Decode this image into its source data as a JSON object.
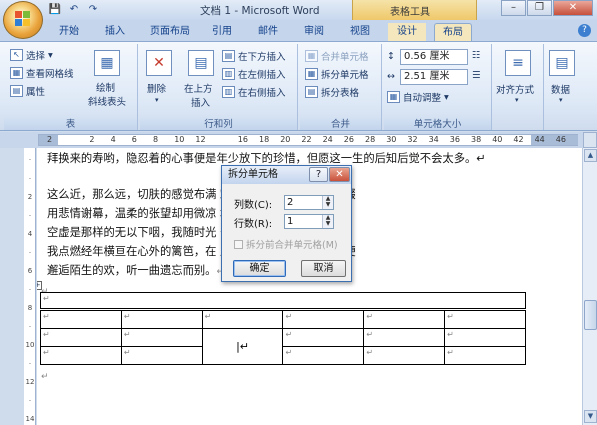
{
  "window": {
    "title": "文档 1 - Microsoft Word",
    "contextual_tab_group": "表格工具",
    "controls": [
      "–",
      "❐",
      "✕"
    ]
  },
  "quick_access": {
    "save": "💾",
    "undo": "↶",
    "redo": "↷"
  },
  "tabs": [
    "开始",
    "插入",
    "页面布局",
    "引用",
    "邮件",
    "审阅",
    "视图",
    "设计",
    "布局"
  ],
  "active_tab": "布局",
  "ribbon": {
    "table_group": {
      "label": "表",
      "select": "选择",
      "gridlines": "查看网格线",
      "properties": "属性"
    },
    "draw_group": {
      "draw_line1": "绘制",
      "draw_line2": "斜线表头"
    },
    "rows_cols_group": {
      "label": "行和列",
      "delete": "删除",
      "insert_above_1": "在上方",
      "insert_above_2": "插入",
      "insert_below": "在下方插入",
      "insert_left": "在左侧插入",
      "insert_right": "在右侧插入"
    },
    "merge_group": {
      "label": "合并",
      "merge_cells": "合并单元格",
      "split_cells": "拆分单元格",
      "split_table": "拆分表格"
    },
    "cell_size_group": {
      "label": "单元格大小",
      "height": "0.56 厘米",
      "width": "2.51 厘米",
      "autofit": "自动调整"
    },
    "alignment": "对齐方式",
    "data": "数据"
  },
  "ruler": {
    "ticks": [
      "2",
      "",
      "2",
      "4",
      "6",
      "8",
      "10",
      "12",
      "",
      "16",
      "18",
      "20",
      "22",
      "24",
      "26",
      "28",
      "30",
      "32",
      "34",
      "36",
      "38",
      "40",
      "42",
      "44",
      "46"
    ],
    "vticks": [
      "",
      "",
      "2",
      "",
      "4",
      "",
      "6",
      "",
      "8",
      "",
      "10",
      "",
      "12",
      "",
      "14"
    ]
  },
  "document": {
    "line0": "拜换来的寿哟，隐忍着的心事便是年少放下的珍惜，但愿这一生的后知后觉不会太多。↵",
    "lines": [
      "这么近，那么远，切肤的感觉布满                                欢离合的宿命，多情的点缀",
      "用悲情谢幕，温柔的张望却用微凉                                地凌乱的心事被独自翻阅，",
      "空虚是那样的无以下咽，我随时光                                安然里顾盼着傲然的孤单，",
      "我点燃经年横亘在心外的篱笆，在                                晨曦和黄昏，跨过记忆的梗",
      "邂逅陌生的欢，听一曲遗忘而别。"
    ],
    "para_mark": "↵",
    "cell_mark": "↵",
    "cursor_cell": "|↵"
  },
  "dialog": {
    "title": "拆分单元格",
    "help": "?",
    "close": "✕",
    "cols_label": "列数(C):",
    "cols_value": "2",
    "rows_label": "行数(R):",
    "rows_value": "1",
    "merge_before_split": "拆分前合并单元格(M)",
    "ok": "确定",
    "cancel": "取消"
  }
}
